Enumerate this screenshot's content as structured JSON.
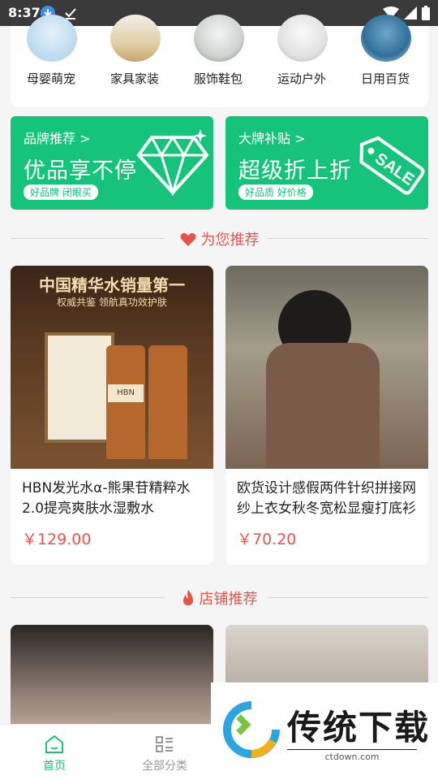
{
  "status": {
    "time": "8:37"
  },
  "categories": [
    {
      "label": "母婴萌宠"
    },
    {
      "label": "家具家装"
    },
    {
      "label": "服饰鞋包"
    },
    {
      "label": "运动户外"
    },
    {
      "label": "日用百货"
    }
  ],
  "banners": [
    {
      "title": "品牌推荐 >",
      "headline": "优品享不停",
      "pill": "好品牌 闭眼买"
    },
    {
      "title": "大牌补贴 >",
      "headline": "超级折上折",
      "pill": "好品质 好价格",
      "tag": "SALE"
    }
  ],
  "sections": {
    "recommend": "为您推荐",
    "shops": "店铺推荐"
  },
  "products": [
    {
      "name": "HBN发光水α-熊果苷精粹水2.0提亮爽肤水湿敷水",
      "price": "￥129.00",
      "img_headline": "中国精华水销量第一",
      "img_sub": "权威共鉴 领航真功效护肤",
      "img_brand": "HBN"
    },
    {
      "name": "欧货设计感假两件针织拼接网纱上衣女秋冬宽松显瘦打底衫",
      "price": "￥70.20"
    }
  ],
  "tabbar": [
    {
      "label": "首页",
      "active": true
    },
    {
      "label": "全部分类",
      "active": false
    }
  ],
  "watermark": {
    "text": "传统下载",
    "sub": "ctdown.com"
  },
  "colors": {
    "accent": "#16c37a",
    "price": "#e8534a"
  }
}
